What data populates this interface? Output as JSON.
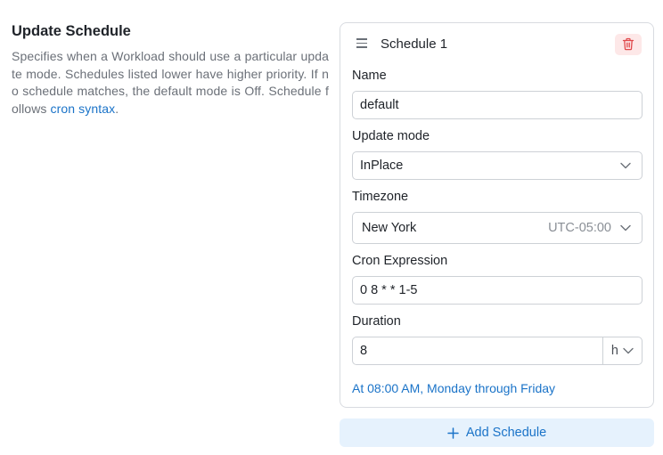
{
  "section": {
    "title": "Update Schedule",
    "description_prefix": "Specifies when a Workload should use a particular update mode. Schedules listed lower have higher priority. If no schedule matches, the default mode is Off. Schedule follows ",
    "link_text": "cron syntax",
    "description_suffix": "."
  },
  "schedule": {
    "title": "Schedule 1",
    "name_label": "Name",
    "name_value": "default",
    "update_mode_label": "Update mode",
    "update_mode_value": "InPlace",
    "timezone_label": "Timezone",
    "timezone_value": "New York",
    "timezone_offset": "UTC-05:00",
    "cron_label": "Cron Expression",
    "cron_value": "0 8 * * 1-5",
    "duration_label": "Duration",
    "duration_value": "8",
    "duration_unit": "h",
    "cron_description": "At 08:00 AM, Monday through Friday"
  },
  "add_button_label": "Add Schedule",
  "colors": {
    "accent": "#1a73c8",
    "danger": "#e0484b",
    "danger_bg": "#fde8e8",
    "add_bg": "#e6f2fd"
  },
  "icons": {
    "drag": "drag-handle-icon",
    "delete": "trash-icon",
    "dropdown": "chevron-down-icon",
    "add": "plus-icon"
  }
}
